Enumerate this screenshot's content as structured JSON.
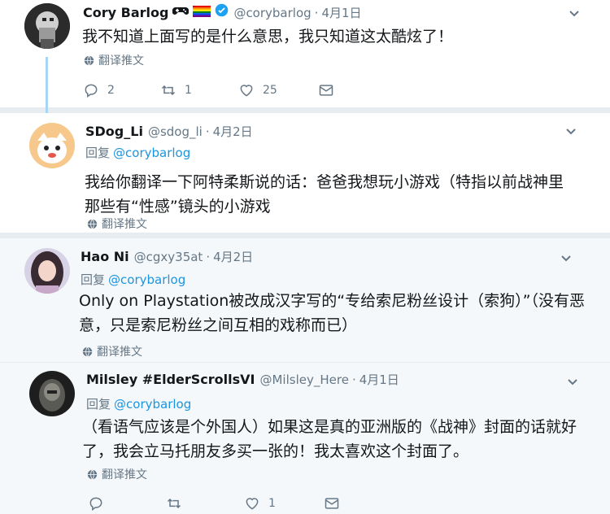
{
  "tweets": [
    {
      "name": "Cory Barlog",
      "handle": "@corybarlog",
      "time": "4月1日",
      "text": "我不知道上面写的是什么意思，我只知道这太酷炫了！",
      "translate": "翻译推文",
      "actions": {
        "replies": "2",
        "retweets": "1",
        "likes": "25"
      }
    },
    {
      "name": "SDog_Li",
      "handle": "@sdog_li",
      "time": "4月2日",
      "reply_label": "回复",
      "reply_mention": "@corybarlog",
      "text": "我给你翻译一下阿特柔斯说的话：爸爸我想玩小游戏（特指以前战神里那些有“性感”镜头的小游戏",
      "translate": "翻译推文"
    },
    {
      "name": "Hao Ni",
      "handle": "@cgxy35at",
      "time": "4月2日",
      "reply_label": "回复",
      "reply_mention": "@corybarlog",
      "text": "Only on Playstation被改成汉字写的“专给索尼粉丝设计（索狗）”（没有恶意，只是索尼粉丝之间互相的戏称而已）",
      "translate": "翻译推文"
    },
    {
      "name": "Milsley #ElderScrollsVI",
      "handle": "@Milsley_Here",
      "time": "4月1日",
      "reply_label": "回复",
      "reply_mention": "@corybarlog",
      "text": "（看语气应该是个外国人）如果这是真的亚洲版的《战神》封面的话就好了，我会立马托朋友多买一张的！我太喜欢这个封面了。",
      "translate": "翻译推文",
      "actions": {
        "likes": "1"
      }
    }
  ],
  "dot": "·",
  "colors": {
    "accent": "#1b95e0",
    "muted": "#657786",
    "text": "#14171a",
    "verified": "#1da1f2"
  }
}
